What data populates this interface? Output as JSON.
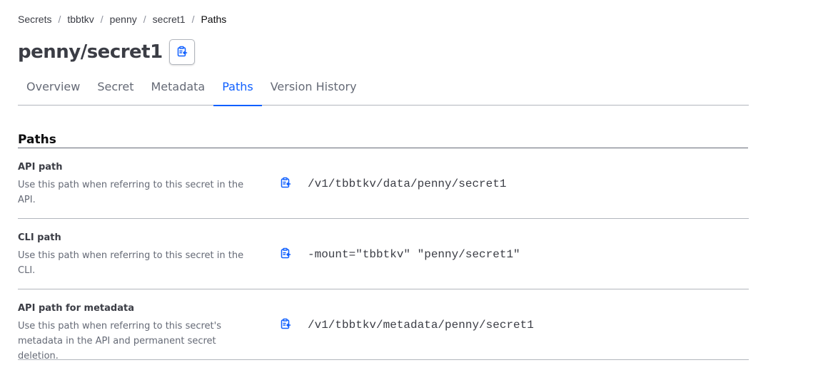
{
  "breadcrumb": {
    "items": [
      "Secrets",
      "tbbtkv",
      "penny",
      "secret1",
      "Paths"
    ],
    "separator": "/"
  },
  "page": {
    "title": "penny/secret1",
    "copy_icon": "clipboard-copy-icon"
  },
  "tabs": [
    {
      "label": "Overview",
      "active": false
    },
    {
      "label": "Secret",
      "active": false
    },
    {
      "label": "Metadata",
      "active": false
    },
    {
      "label": "Paths",
      "active": true
    },
    {
      "label": "Version History",
      "active": false
    }
  ],
  "section": {
    "title": "Paths"
  },
  "paths": [
    {
      "label": "API path",
      "description": "Use this path when referring to this secret in the API.",
      "value": "/v1/tbbtkv/data/penny/secret1"
    },
    {
      "label": "CLI path",
      "description": "Use this path when referring to this secret in the CLI.",
      "value": "-mount=\"tbbtkv\" \"penny/secret1\""
    },
    {
      "label": "API path for metadata",
      "description": "Use this path when referring to this secret's metadata in the API and permanent secret deletion.",
      "value": "/v1/tbbtkv/metadata/penny/secret1"
    }
  ],
  "colors": {
    "accent": "#1060ff",
    "text": "#3b3d45",
    "muted": "#656a76",
    "border": "#b2b6bd"
  }
}
